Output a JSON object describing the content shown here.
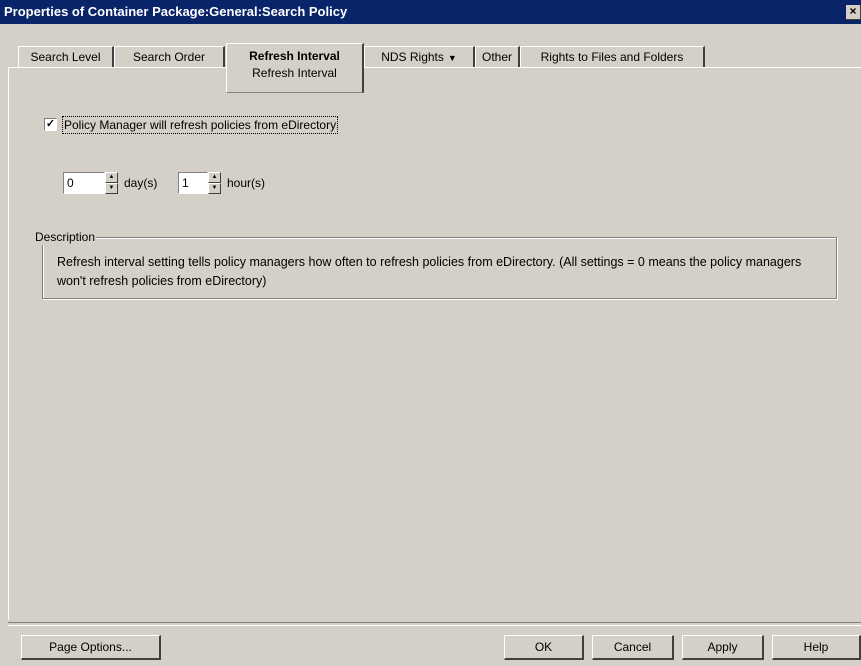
{
  "window": {
    "title": "Properties of Container Package:General:Search Policy",
    "close_glyph": "×"
  },
  "tabs": [
    {
      "label": "Search Level"
    },
    {
      "label": "Search Order"
    },
    {
      "label": "Refresh Interval",
      "sublabel": "Refresh Interval",
      "active": true
    },
    {
      "label": "NDS Rights",
      "dropdown_icon": "▼"
    },
    {
      "label": "Other"
    },
    {
      "label": "Rights to Files and Folders"
    }
  ],
  "refresh": {
    "checkbox_label": "Policy Manager will refresh policies from eDirectory",
    "checkbox_checked": true,
    "checkbox_glyph": "✓",
    "days_value": "0",
    "days_label": "day(s)",
    "hours_value": "1",
    "hours_label": "hour(s)",
    "up_glyph": "▲",
    "down_glyph": "▼"
  },
  "description": {
    "title": "Description",
    "text": "Refresh interval setting tells policy managers how often to refresh policies from eDirectory.  (All settings = 0 means the policy managers won't refresh policies from eDirectory)"
  },
  "buttons": {
    "page_options": "Page Options...",
    "ok": "OK",
    "cancel": "Cancel",
    "apply": "Apply",
    "help": "Help"
  }
}
